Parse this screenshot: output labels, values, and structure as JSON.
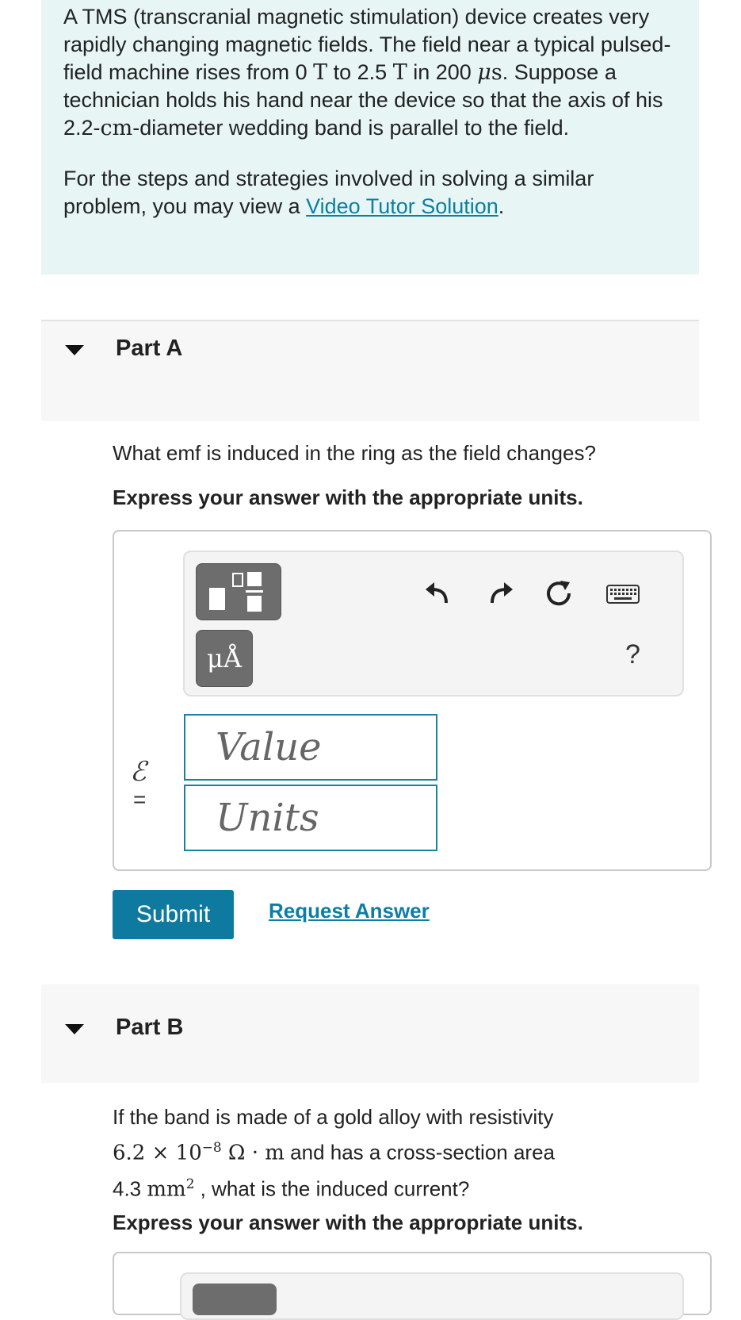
{
  "intro": {
    "p1_a": "A TMS (transcranial magnetic stimulation) device creates very rapidly changing magnetic fields. The field near a typical pulsed-field machine rises from 0 ",
    "unit_T1": "T",
    "p1_b": " to 2.5 ",
    "unit_T2": "T",
    "p1_c": " in 200 ",
    "unit_mu": "μ",
    "unit_s": "s",
    "p1_d": ". Suppose a technician holds his hand near the device so that the axis of his 2.2-",
    "unit_cm": "cm",
    "p1_e": "-diameter wedding band is parallel to the field.",
    "p2_a": "For the steps and strategies involved in solving a similar problem, you may view a ",
    "p2_link": "Video Tutor Solution",
    "p2_b": "."
  },
  "partA": {
    "title": "Part A",
    "question": "What emf is induced in the ring as the field changes?",
    "instruction": "Express your answer with the appropriate units.",
    "units_button": "μÅ",
    "help": "?",
    "symbol": "ℰ",
    "equals": "=",
    "value_placeholder": "Value",
    "units_placeholder": "Units",
    "submit": "Submit",
    "request": "Request Answer"
  },
  "partB": {
    "title": "Part B",
    "q_a": "If the band is made of a gold alloy with resistivity",
    "q_num": "6.2 × 10",
    "q_exp": "−8",
    "q_unit": " Ω · m",
    "q_b": " and has a cross-section area",
    "q_c": "4.3 ",
    "q_mm": "mm",
    "q_mm_exp": "2",
    "q_d": " , what is the induced current?",
    "instruction": "Express your answer with the appropriate units."
  }
}
